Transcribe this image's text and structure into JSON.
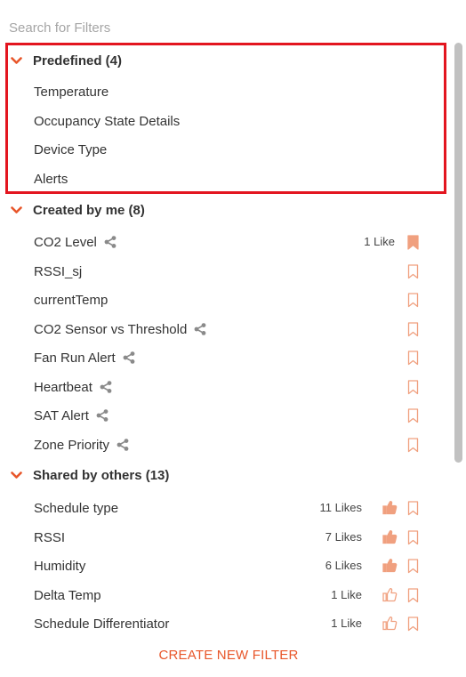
{
  "search": {
    "placeholder": "Search for Filters"
  },
  "colors": {
    "accent": "#e8562a",
    "highlight_border": "#e3151f",
    "bookmark": "#f0a07f",
    "thumb": "#f0a07f"
  },
  "sections": {
    "predefined": {
      "label": "Predefined (4)",
      "items": [
        "Temperature",
        "Occupancy State Details",
        "Device Type",
        "Alerts"
      ]
    },
    "created": {
      "label": "Created by me (8)",
      "items": [
        {
          "label": "CO2 Level",
          "shared": true,
          "likes": "1 Like",
          "bookmarked": true
        },
        {
          "label": "RSSI_sj",
          "shared": false,
          "likes": "",
          "bookmarked": false
        },
        {
          "label": "currentTemp",
          "shared": false,
          "likes": "",
          "bookmarked": false
        },
        {
          "label": "CO2 Sensor vs Threshold",
          "shared": true,
          "likes": "",
          "bookmarked": false
        },
        {
          "label": "Fan Run Alert",
          "shared": true,
          "likes": "",
          "bookmarked": false
        },
        {
          "label": "Heartbeat",
          "shared": true,
          "likes": "",
          "bookmarked": false
        },
        {
          "label": "SAT Alert",
          "shared": true,
          "likes": "",
          "bookmarked": false
        },
        {
          "label": "Zone Priority",
          "shared": true,
          "likes": "",
          "bookmarked": false
        }
      ]
    },
    "shared": {
      "label": "Shared by others (13)",
      "items": [
        {
          "label": "Schedule type",
          "likes": "11 Likes",
          "liked": true
        },
        {
          "label": "RSSI",
          "likes": "7 Likes",
          "liked": true
        },
        {
          "label": "Humidity",
          "likes": "6 Likes",
          "liked": true
        },
        {
          "label": "Delta Temp",
          "likes": "1 Like",
          "liked": false
        },
        {
          "label": "Schedule Differentiator",
          "likes": "1 Like",
          "liked": false
        }
      ]
    }
  },
  "footer": {
    "create_label": "CREATE NEW FILTER"
  }
}
